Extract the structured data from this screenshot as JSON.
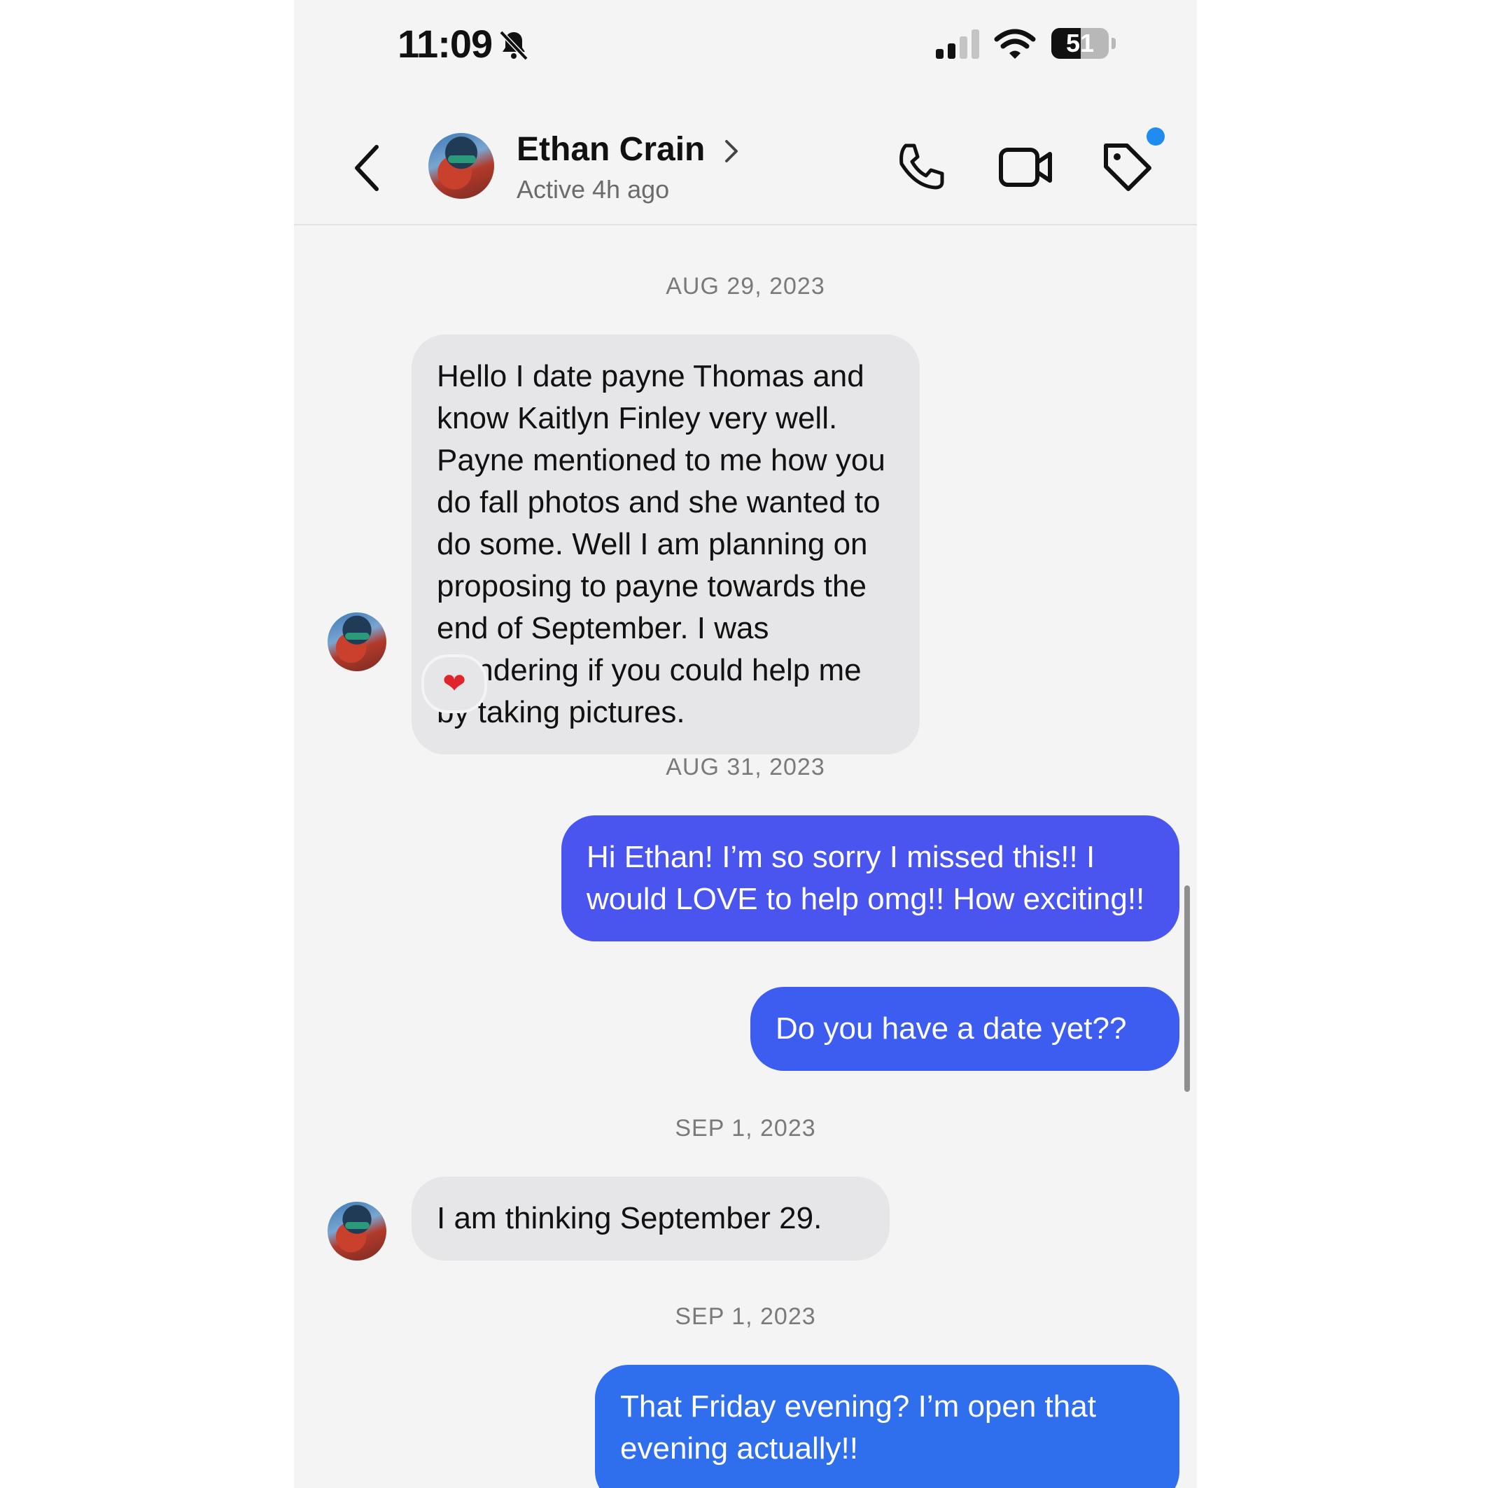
{
  "status_bar": {
    "time": "11:09",
    "battery_percent": "51",
    "battery_level": 0.51,
    "icons": [
      "bell-slash-icon",
      "signal-icon",
      "wifi-icon",
      "battery-icon"
    ]
  },
  "header": {
    "contact_name": "Ethan Crain",
    "contact_status": "Active 4h ago",
    "icons": [
      "back-chevron-icon",
      "chevron-right-icon",
      "phone-icon",
      "video-icon",
      "tag-icon"
    ]
  },
  "colors": {
    "outgoing_bubble_purple": "#4a55f0",
    "outgoing_bubble_blue": "#2f6fee",
    "incoming_bubble": "#e6e6e8",
    "notification_dot": "#1e8cf0"
  },
  "conversation": {
    "date_1": "AUG 29, 2023",
    "msg_1": "Hello I date payne Thomas and know Kaitlyn Finley very well. Payne mentioned to me how you do fall photos and she wanted to do some. Well I am planning on proposing to payne towards the end of September. I was wondering if you could help me by taking pictures.",
    "msg_1_reaction": "❤",
    "date_2": "AUG 31, 2023",
    "msg_2": "Hi Ethan! I’m so sorry I missed this!! I would LOVE to help omg!! How exciting!!",
    "msg_3": "Do you have a date yet??",
    "date_3": "SEP 1, 2023",
    "msg_4": "I am thinking September 29.",
    "date_4": "SEP 1, 2023",
    "msg_5": "That Friday evening? I’m open that evening actually!!"
  }
}
